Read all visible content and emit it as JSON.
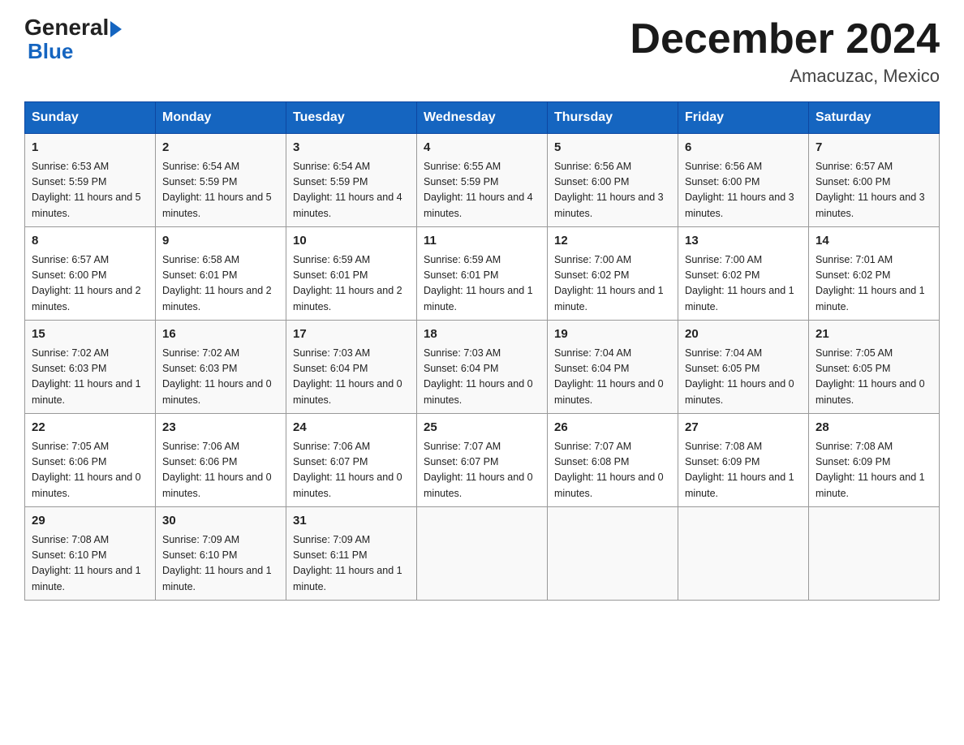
{
  "header": {
    "logo_general": "General",
    "logo_blue": "Blue",
    "title": "December 2024",
    "subtitle": "Amacuzac, Mexico"
  },
  "days_of_week": [
    "Sunday",
    "Monday",
    "Tuesday",
    "Wednesday",
    "Thursday",
    "Friday",
    "Saturday"
  ],
  "weeks": [
    [
      {
        "day": 1,
        "sunrise": "6:53 AM",
        "sunset": "5:59 PM",
        "daylight": "11 hours and 5 minutes."
      },
      {
        "day": 2,
        "sunrise": "6:54 AM",
        "sunset": "5:59 PM",
        "daylight": "11 hours and 5 minutes."
      },
      {
        "day": 3,
        "sunrise": "6:54 AM",
        "sunset": "5:59 PM",
        "daylight": "11 hours and 4 minutes."
      },
      {
        "day": 4,
        "sunrise": "6:55 AM",
        "sunset": "5:59 PM",
        "daylight": "11 hours and 4 minutes."
      },
      {
        "day": 5,
        "sunrise": "6:56 AM",
        "sunset": "6:00 PM",
        "daylight": "11 hours and 3 minutes."
      },
      {
        "day": 6,
        "sunrise": "6:56 AM",
        "sunset": "6:00 PM",
        "daylight": "11 hours and 3 minutes."
      },
      {
        "day": 7,
        "sunrise": "6:57 AM",
        "sunset": "6:00 PM",
        "daylight": "11 hours and 3 minutes."
      }
    ],
    [
      {
        "day": 8,
        "sunrise": "6:57 AM",
        "sunset": "6:00 PM",
        "daylight": "11 hours and 2 minutes."
      },
      {
        "day": 9,
        "sunrise": "6:58 AM",
        "sunset": "6:01 PM",
        "daylight": "11 hours and 2 minutes."
      },
      {
        "day": 10,
        "sunrise": "6:59 AM",
        "sunset": "6:01 PM",
        "daylight": "11 hours and 2 minutes."
      },
      {
        "day": 11,
        "sunrise": "6:59 AM",
        "sunset": "6:01 PM",
        "daylight": "11 hours and 1 minute."
      },
      {
        "day": 12,
        "sunrise": "7:00 AM",
        "sunset": "6:02 PM",
        "daylight": "11 hours and 1 minute."
      },
      {
        "day": 13,
        "sunrise": "7:00 AM",
        "sunset": "6:02 PM",
        "daylight": "11 hours and 1 minute."
      },
      {
        "day": 14,
        "sunrise": "7:01 AM",
        "sunset": "6:02 PM",
        "daylight": "11 hours and 1 minute."
      }
    ],
    [
      {
        "day": 15,
        "sunrise": "7:02 AM",
        "sunset": "6:03 PM",
        "daylight": "11 hours and 1 minute."
      },
      {
        "day": 16,
        "sunrise": "7:02 AM",
        "sunset": "6:03 PM",
        "daylight": "11 hours and 0 minutes."
      },
      {
        "day": 17,
        "sunrise": "7:03 AM",
        "sunset": "6:04 PM",
        "daylight": "11 hours and 0 minutes."
      },
      {
        "day": 18,
        "sunrise": "7:03 AM",
        "sunset": "6:04 PM",
        "daylight": "11 hours and 0 minutes."
      },
      {
        "day": 19,
        "sunrise": "7:04 AM",
        "sunset": "6:04 PM",
        "daylight": "11 hours and 0 minutes."
      },
      {
        "day": 20,
        "sunrise": "7:04 AM",
        "sunset": "6:05 PM",
        "daylight": "11 hours and 0 minutes."
      },
      {
        "day": 21,
        "sunrise": "7:05 AM",
        "sunset": "6:05 PM",
        "daylight": "11 hours and 0 minutes."
      }
    ],
    [
      {
        "day": 22,
        "sunrise": "7:05 AM",
        "sunset": "6:06 PM",
        "daylight": "11 hours and 0 minutes."
      },
      {
        "day": 23,
        "sunrise": "7:06 AM",
        "sunset": "6:06 PM",
        "daylight": "11 hours and 0 minutes."
      },
      {
        "day": 24,
        "sunrise": "7:06 AM",
        "sunset": "6:07 PM",
        "daylight": "11 hours and 0 minutes."
      },
      {
        "day": 25,
        "sunrise": "7:07 AM",
        "sunset": "6:07 PM",
        "daylight": "11 hours and 0 minutes."
      },
      {
        "day": 26,
        "sunrise": "7:07 AM",
        "sunset": "6:08 PM",
        "daylight": "11 hours and 0 minutes."
      },
      {
        "day": 27,
        "sunrise": "7:08 AM",
        "sunset": "6:09 PM",
        "daylight": "11 hours and 1 minute."
      },
      {
        "day": 28,
        "sunrise": "7:08 AM",
        "sunset": "6:09 PM",
        "daylight": "11 hours and 1 minute."
      }
    ],
    [
      {
        "day": 29,
        "sunrise": "7:08 AM",
        "sunset": "6:10 PM",
        "daylight": "11 hours and 1 minute."
      },
      {
        "day": 30,
        "sunrise": "7:09 AM",
        "sunset": "6:10 PM",
        "daylight": "11 hours and 1 minute."
      },
      {
        "day": 31,
        "sunrise": "7:09 AM",
        "sunset": "6:11 PM",
        "daylight": "11 hours and 1 minute."
      },
      null,
      null,
      null,
      null
    ]
  ]
}
